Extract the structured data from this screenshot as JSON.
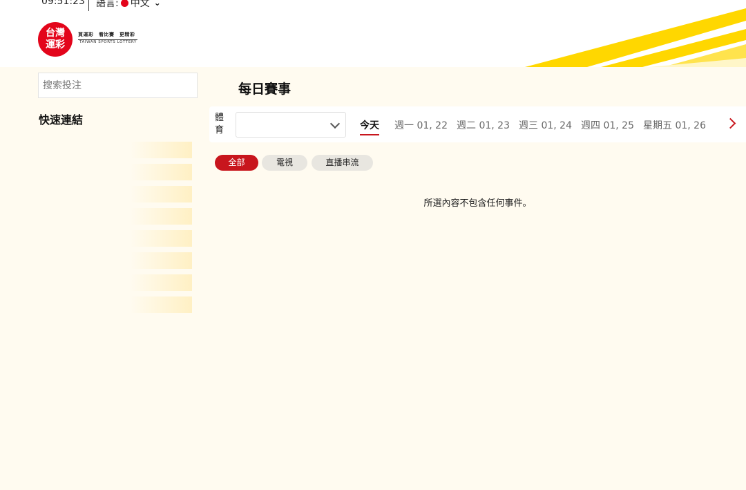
{
  "header": {
    "clock": "09:51:23",
    "language_label": "語言:",
    "language_value": "中文",
    "logo": {
      "mark_line1": "台灣",
      "mark_line2": "運彩",
      "slogan": "買運彩　看比賽　更精彩",
      "english": "TAIWAN SPORTS LOTTERY"
    },
    "stripe_color": "#ffd700"
  },
  "sidebar": {
    "search_placeholder": "搜索投注",
    "quick_links_title": "快速連結",
    "quick_links": [
      "",
      "",
      "",
      "",
      "",
      "",
      "",
      ""
    ]
  },
  "main": {
    "title": "每日賽事",
    "sport_label": "體育",
    "sport_select_value": "",
    "days": [
      {
        "label": "今天",
        "active": true
      },
      {
        "label": "週一 01, 22"
      },
      {
        "label": "週二 01, 23"
      },
      {
        "label": "週三 01, 24"
      },
      {
        "label": "週四 01, 25"
      },
      {
        "label": "星期五 01, 26"
      }
    ],
    "filters": [
      {
        "label": "全部",
        "active": true
      },
      {
        "label": "電視"
      },
      {
        "label": "直播串流"
      }
    ],
    "empty_message": "所選內容不包含任何事件。"
  },
  "colors": {
    "accent": "#c8161d",
    "background": "#fffbf0",
    "stripe": "#ffd700"
  }
}
